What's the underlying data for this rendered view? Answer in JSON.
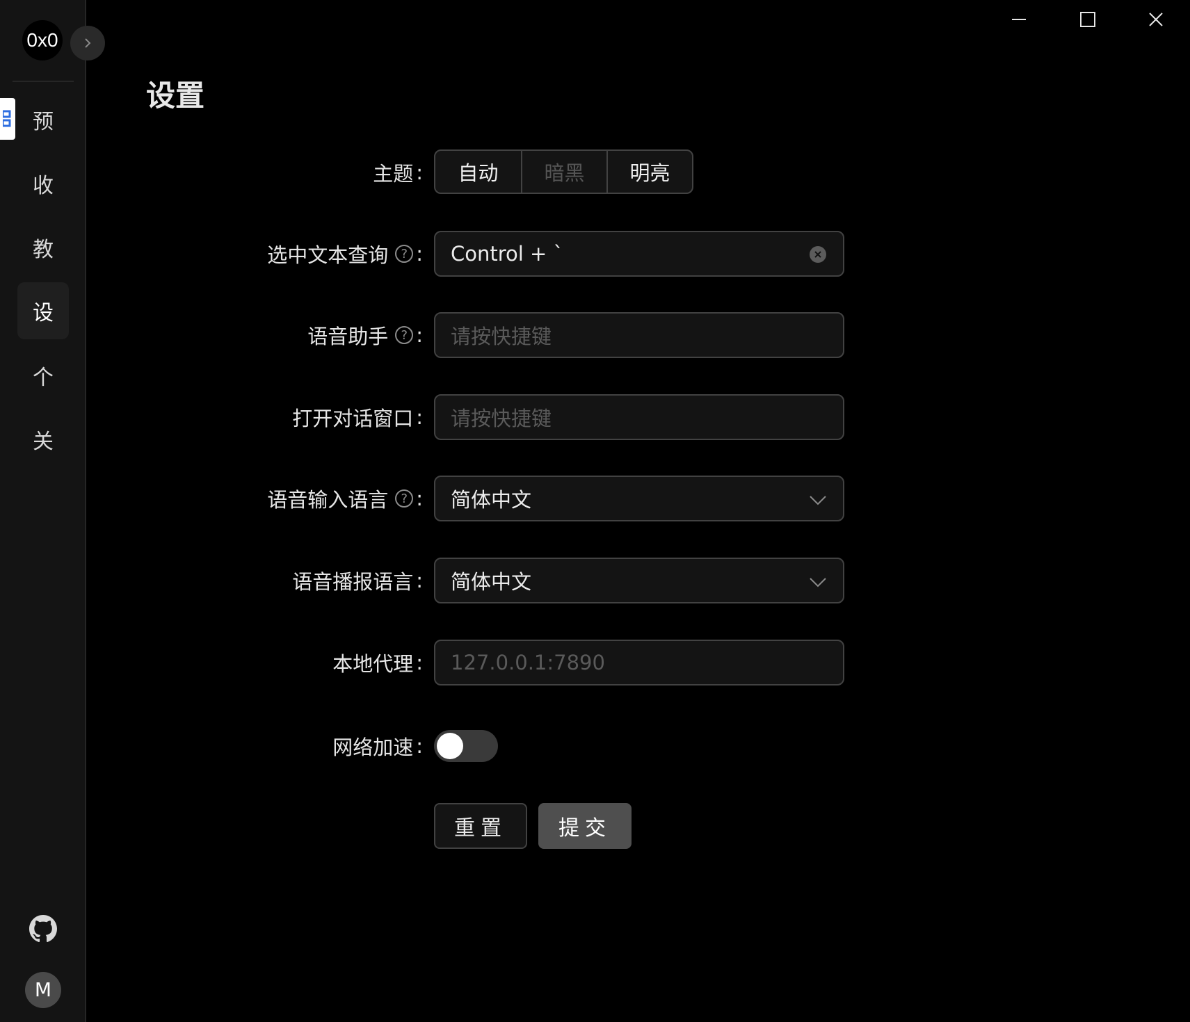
{
  "app": {
    "logo_text": "0x0",
    "page_title": "设置"
  },
  "sidebar": {
    "items": [
      {
        "label": "预",
        "active": false
      },
      {
        "label": "收",
        "active": false
      },
      {
        "label": "教",
        "active": false
      },
      {
        "label": "设",
        "active": true
      },
      {
        "label": "个",
        "active": false
      },
      {
        "label": "关",
        "active": false
      }
    ],
    "avatar_letter": "M"
  },
  "form": {
    "theme": {
      "label": "主题",
      "options": [
        "自动",
        "暗黑",
        "明亮"
      ],
      "selected": "暗黑"
    },
    "selection_query": {
      "label": "选中文本查询",
      "value": "Control + `"
    },
    "voice_assistant": {
      "label": "语音助手",
      "placeholder": "请按快捷键"
    },
    "open_dialog": {
      "label": "打开对话窗口",
      "placeholder": "请按快捷键"
    },
    "voice_input_language": {
      "label": "语音输入语言",
      "value": "简体中文"
    },
    "voice_broadcast_language": {
      "label": "语音播报语言",
      "value": "简体中文"
    },
    "local_proxy": {
      "label": "本地代理",
      "placeholder": "127.0.0.1:7890"
    },
    "network_acceleration": {
      "label": "网络加速",
      "enabled": false
    },
    "colon": ":",
    "help_glyph": "?",
    "reset_label": "重置",
    "submit_label": "提交"
  },
  "colors": {
    "background": "#000000",
    "sidebar": "#141414",
    "submit": "#4f4f4f"
  }
}
